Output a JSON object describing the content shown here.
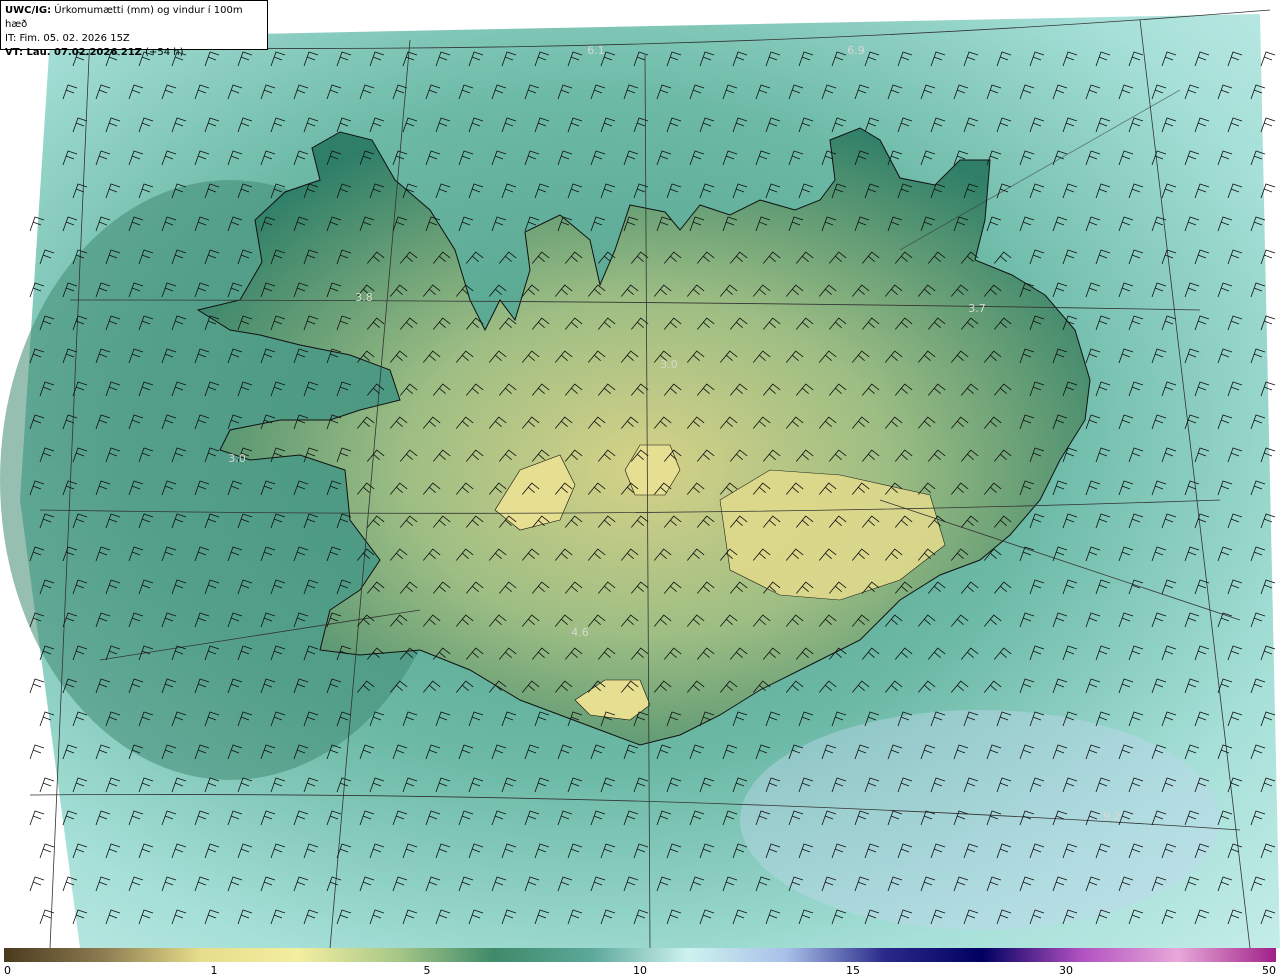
{
  "header": {
    "model": "UWC/IG:",
    "title": "Úrkomumætti (mm) og vindur í 100m hæð",
    "init_time": "IT: Fim. 05. 02. 2026 15Z",
    "valid_label": "VT: Lau. 07.02.2026 21Z",
    "valid_offset": "(+54 h)"
  },
  "map_labels": [
    "6.1",
    "6.9",
    "3.8",
    "3.7",
    "3.0",
    "3.0",
    "4.6",
    "9.2"
  ],
  "colorbar": {
    "ticks": [
      "0",
      "1",
      "5",
      "10",
      "15",
      "30",
      "50"
    ],
    "colors": [
      "#4a3a1e",
      "#8c7a50",
      "#e6dd8a",
      "#f4eea0",
      "#a8c888",
      "#3f8a6a",
      "#5ca89a",
      "#cdf2ef",
      "#a8c0e8",
      "#2a2a8a",
      "#000060",
      "#b050c0",
      "#e8a8d8",
      "#a02088"
    ]
  },
  "colors": {
    "sea": "#7fc6b8",
    "land_low": "#2f7f68",
    "land_high": "#d8d488",
    "coast": "#111111",
    "barb": "#111111",
    "grid": "#333333"
  }
}
